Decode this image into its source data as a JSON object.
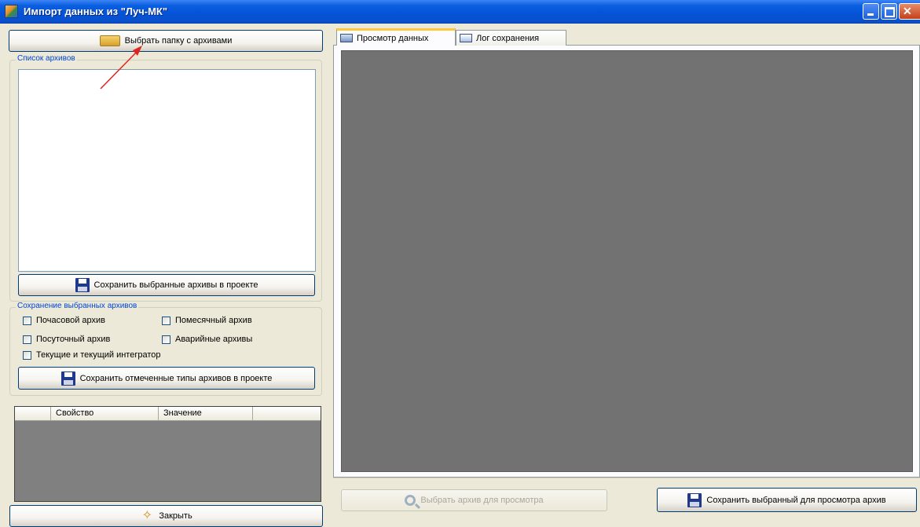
{
  "window": {
    "title": "Импорт данных из \"Луч-МК\"",
    "controls": [
      "minimize",
      "maximize",
      "close"
    ]
  },
  "left": {
    "select_folder_button": "Выбрать папку с архивами",
    "archive_list_group": "Список архивов",
    "save_selected_button": "Сохранить выбранные архивы в проекте",
    "save_types_group": "Сохранение выбранных архивов",
    "checkboxes": [
      {
        "label": "Почасовой архив",
        "checked": false
      },
      {
        "label": "Помесячный архив",
        "checked": false
      },
      {
        "label": "Посуточный архив",
        "checked": false
      },
      {
        "label": "Аварийные архивы",
        "checked": false
      },
      {
        "label": "Текущие и текущий интегратор",
        "checked": false
      }
    ],
    "save_types_button": "Сохранить отмеченные типы архивов в проекте",
    "grid_columns": [
      "Свойство",
      "Значение"
    ],
    "close_button": "Закрыть"
  },
  "right": {
    "tabs": [
      {
        "label": "Просмотр данных",
        "active": true
      },
      {
        "label": "Лог сохранения",
        "active": false
      }
    ],
    "select_archive_button": "Выбрать архив для просмотра",
    "save_viewed_button": "Сохранить выбранный для просмотра архив"
  },
  "colors": {
    "title_bar": "#0553d8",
    "window_bg": "#ece9d8",
    "viewer_bg": "#727272",
    "grid_bg": "#808080",
    "annotation_arrow": "#e0231e",
    "legend_text": "#0046d5"
  }
}
